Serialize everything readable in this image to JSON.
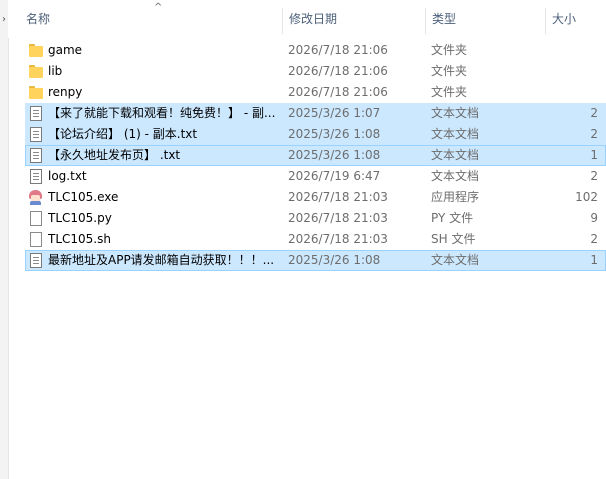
{
  "gutter": {
    "chevron": "›"
  },
  "header": {
    "sort_indicator": "^",
    "columns": {
      "name": "名称",
      "date": "修改日期",
      "type": "类型",
      "size": "大小"
    }
  },
  "files": [
    {
      "name": "game",
      "date": "2026/7/18 21:06",
      "type": "文件夹",
      "size": "",
      "icon": "folder-icon",
      "selected": false
    },
    {
      "name": "lib",
      "date": "2026/7/18 21:06",
      "type": "文件夹",
      "size": "",
      "icon": "folder-icon",
      "selected": false
    },
    {
      "name": "renpy",
      "date": "2026/7/18 21:06",
      "type": "文件夹",
      "size": "",
      "icon": "folder-icon",
      "selected": false
    },
    {
      "name": "【来了就能下载和观看！纯免费！】 - 副...",
      "date": "2025/3/26 1:07",
      "type": "文本文档",
      "size": "2",
      "icon": "text-file-icon",
      "selected": true
    },
    {
      "name": "【论坛介绍】 (1) - 副本.txt",
      "date": "2025/3/26 1:08",
      "type": "文本文档",
      "size": "2",
      "icon": "text-file-icon",
      "selected": true
    },
    {
      "name": "【永久地址发布页】 .txt",
      "date": "2025/3/26 1:08",
      "type": "文本文档",
      "size": "1",
      "icon": "text-file-icon",
      "selected": true
    },
    {
      "name": "log.txt",
      "date": "2026/7/19 6:47",
      "type": "文本文档",
      "size": "2",
      "icon": "text-file-icon",
      "selected": false
    },
    {
      "name": "TLC105.exe",
      "date": "2026/7/18 21:03",
      "type": "应用程序",
      "size": "102",
      "icon": "app-icon",
      "selected": false
    },
    {
      "name": "TLC105.py",
      "date": "2026/7/18 21:03",
      "type": "PY 文件",
      "size": "9",
      "icon": "py-file-icon",
      "selected": false
    },
    {
      "name": "TLC105.sh",
      "date": "2026/7/18 21:03",
      "type": "SH 文件",
      "size": "2",
      "icon": "sh-file-icon",
      "selected": false
    },
    {
      "name": "最新地址及APP请发邮箱自动获取！！！...",
      "date": "2025/3/26 1:08",
      "type": "文本文档",
      "size": "1",
      "icon": "text-file-icon",
      "selected": true
    }
  ],
  "colors": {
    "selection": "#cce8ff",
    "selection_border": "#99d1ff",
    "header_text": "#4c607a",
    "folder": "#ffd35c"
  }
}
